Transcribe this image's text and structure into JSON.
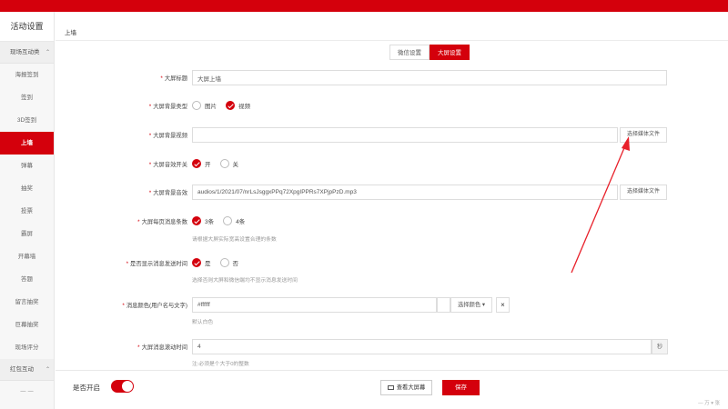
{
  "sidebar": {
    "title": "活动设置",
    "group1": "现场互动类",
    "group1_caret": "⌃",
    "items": [
      "海报签到",
      "签到",
      "3D签到",
      "上墙",
      "弹幕",
      "抽奖",
      "投票",
      "霸屏",
      "开幕墙",
      "答题",
      "留言抽奖",
      "巨幕抽奖",
      "现场评分"
    ],
    "active_index": 3,
    "group2": "红包互动",
    "group2_caret": "⌃",
    "partial": "一 一"
  },
  "breadcrumb": "上墙",
  "tabs": [
    {
      "label": "微信设置",
      "active": false
    },
    {
      "label": "大屏设置",
      "active": true
    }
  ],
  "form": {
    "title": {
      "label": "大屏标题",
      "value": "大屏上墙"
    },
    "bg_type": {
      "label": "大屏背景类型",
      "options": [
        "图片",
        "视频"
      ],
      "selected": 1
    },
    "bg_video": {
      "label": "大屏背景视频",
      "value": "",
      "button": "选择媒体文件"
    },
    "sound_switch": {
      "label": "大屏音效开关",
      "options": [
        "开",
        "关"
      ],
      "selected": 0
    },
    "bg_sound": {
      "label": "大屏背景音效",
      "value": "audios/1/2021/07/nrLsJsggxPPq72XpgIPPRs7XPjpPzD.mp3",
      "button": "选择媒体文件"
    },
    "per_page": {
      "label": "大屏每页消息条数",
      "options": [
        "3条",
        "4条"
      ],
      "selected": 0,
      "hint": "请根据大屏实际宽高设置合理的条数"
    },
    "show_time": {
      "label": "是否显示消息发送时间",
      "options": [
        "是",
        "否"
      ],
      "selected": 0,
      "hint": "选择否则大屏和微信端均不显示消息发送时间"
    },
    "msg_color": {
      "label": "消息颜色(用户名与文字)",
      "value": "#ffffff",
      "button": "选择颜色 ▾",
      "clear": "×",
      "hint": "默认白色"
    },
    "scroll_time": {
      "label": "大屏消息滚动时间",
      "value": "4",
      "unit": "秒",
      "hint": "注:必须是个大于0的整数"
    }
  },
  "footer": {
    "enable_label": "是否开启",
    "enabled": true,
    "preview": "查看大屏幕",
    "save": "保存"
  },
  "corner_text": "— 万 ▾ 张",
  "colors": {
    "accent": "#d4000c"
  }
}
